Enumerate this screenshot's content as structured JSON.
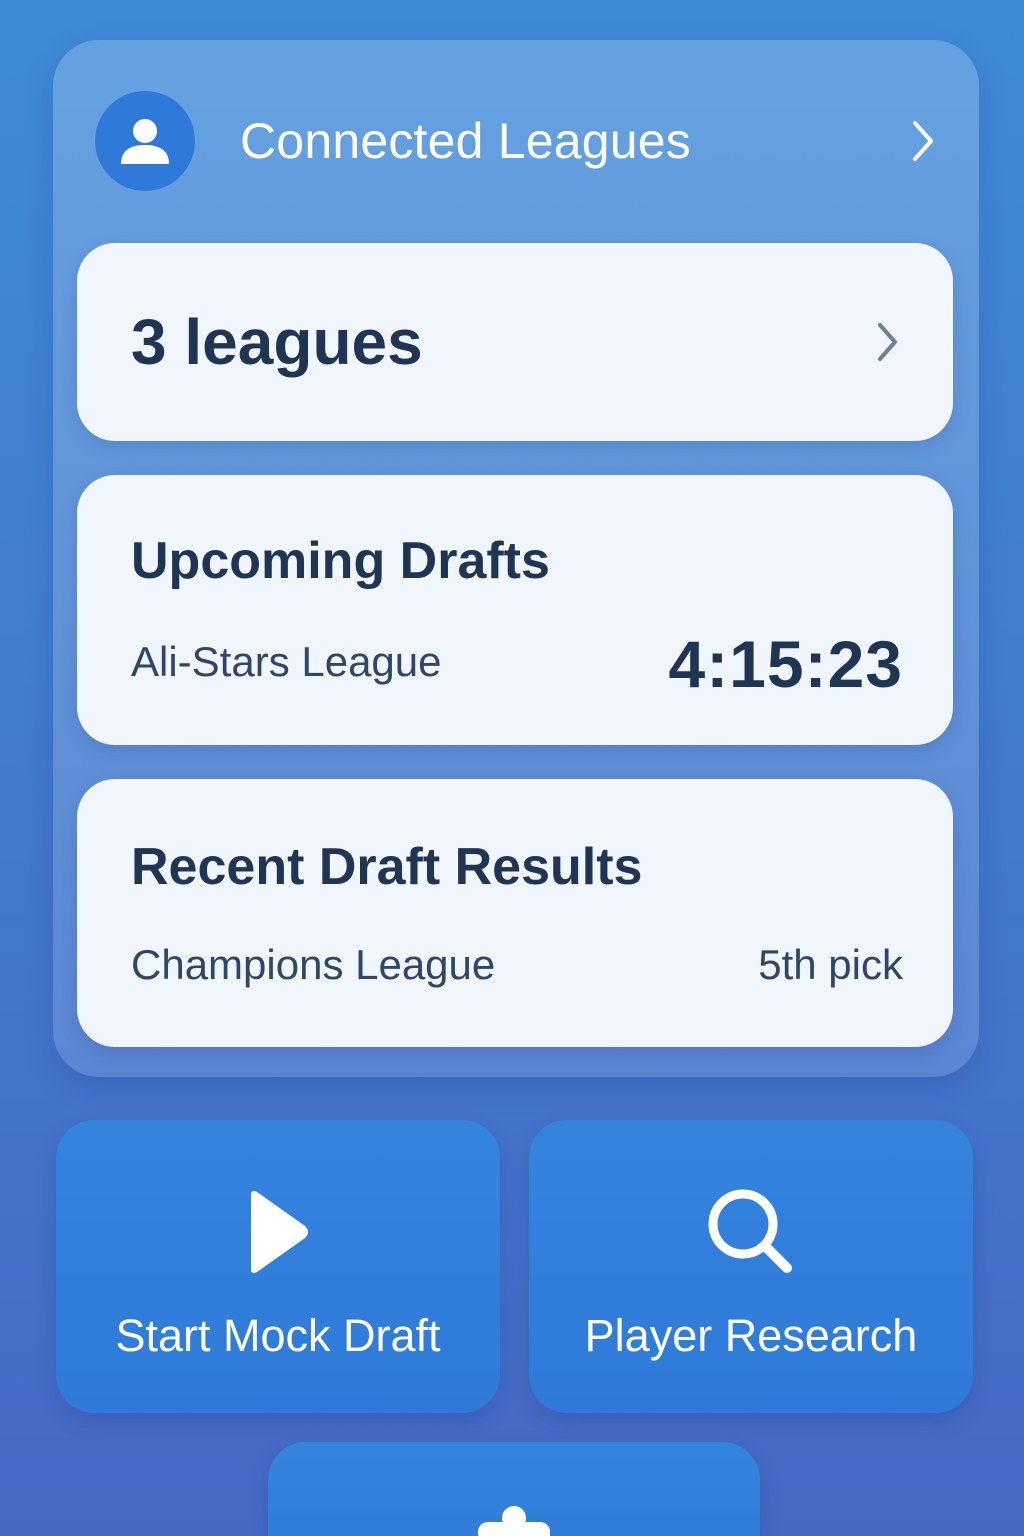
{
  "connected_leagues": {
    "title": "Connected Leagues",
    "icon": "user-icon",
    "count_label": "3 leagues"
  },
  "upcoming_drafts": {
    "title": "Upcoming Drafts",
    "league": "Ali-Stars League",
    "countdown": "4:15:23"
  },
  "recent_results": {
    "title": "Recent Draft Results",
    "league": "Champions League",
    "pick": "5th pick"
  },
  "actions": [
    {
      "label": "Start Mock Draft",
      "icon": "play-icon"
    },
    {
      "label": "Player Research",
      "icon": "search-icon"
    },
    {
      "label": "",
      "icon": "puzzle-icon"
    }
  ],
  "colors": {
    "background": "#4474cc",
    "accent": "#2f7ad8",
    "card": "#f1f5fc",
    "text_dark": "#1f3553"
  }
}
